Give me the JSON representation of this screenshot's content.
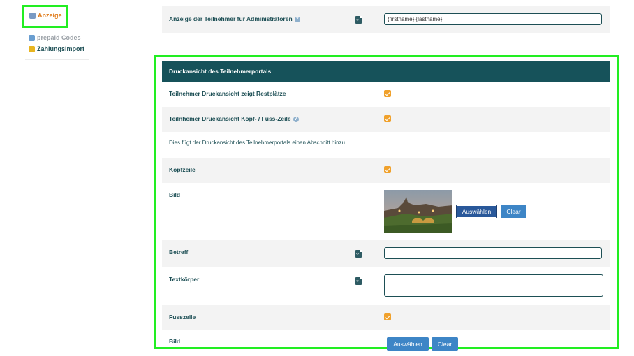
{
  "sidebar": {
    "items": [
      {
        "label": "Anzeige",
        "icon": "monitor-icon",
        "active": true
      },
      {
        "label": "prepaid Codes",
        "icon": "voucher-icon",
        "active": false
      },
      {
        "label": "Zahlungsimport",
        "icon": "money-icon",
        "active": false
      }
    ]
  },
  "admin_row": {
    "label": "Anzeige der Teilnehmer für Administratoren",
    "value": "{firstname} {lastname}"
  },
  "print_section": {
    "title": "Druckansicht des Teilnehmerportals",
    "rows": {
      "restplaetze": {
        "label": "Teilnehmer Druckansicht zeigt Restplätze",
        "checked": true
      },
      "kopf_fuss": {
        "label": "Teilnhemer Druckansicht Kopf- / Fuss-Zeile",
        "checked": true
      },
      "note": "Dies fügt der Druckansicht des Teilnehmerportals einen Abschnitt hinzu.",
      "kopfzeile": {
        "label": "Kopfzeile",
        "checked": true
      },
      "bild1": {
        "label": "Bild",
        "select_label": "Auswählen",
        "clear_label": "Clear"
      },
      "betreff": {
        "label": "Betreff",
        "value": ""
      },
      "textkoerper": {
        "label": "Textkörper",
        "value": ""
      },
      "fusszeile": {
        "label": "Fusszeile",
        "checked": true
      },
      "bild2": {
        "label": "Bild",
        "select_label": "Auswählen",
        "clear_label": "Clear"
      }
    }
  },
  "colors": {
    "header_bg": "#16525a",
    "accent_orange": "#f0a12c",
    "button_blue": "#3d85c6",
    "highlight_green": "#22ee22"
  }
}
